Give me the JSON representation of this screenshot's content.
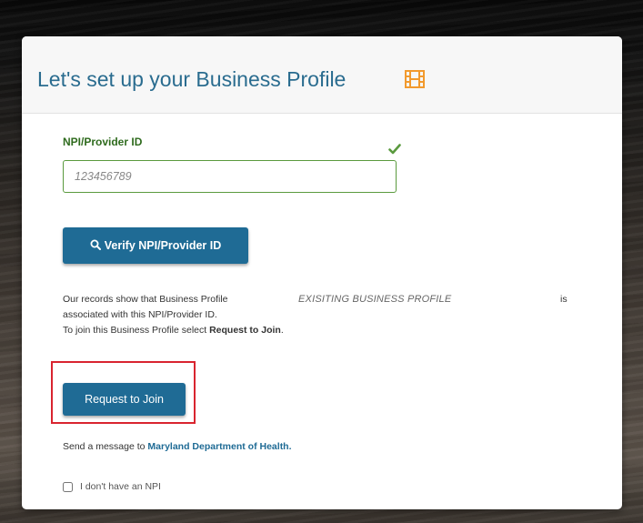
{
  "header": {
    "title": "Let's set up your Business Profile",
    "title_icon": "film-icon",
    "title_color": "#2a6c8f",
    "icon_color": "#f29a2e"
  },
  "npi_field": {
    "label": "NPI/Provider ID",
    "value": "",
    "placeholder": "123456789",
    "valid_icon": "check-icon",
    "valid_color": "#5a9a3e"
  },
  "verify_button": {
    "icon": "search-icon",
    "label": "Verify NPI/Provider ID"
  },
  "records_info": {
    "line1_text": "Our records show that Business Profile",
    "business_profile_name": "EXISITING BUSINESS PROFILE",
    "line1_suffix": "is",
    "line2_text": "associated with this NPI/Provider ID.",
    "line3_prefix": "To join this Business Profile select",
    "line3_action": "Request to Join",
    "line3_suffix": "."
  },
  "join_button": {
    "label": "Request to Join",
    "highlight_color": "#d9242f"
  },
  "message": {
    "prefix": "Send a message to",
    "link": "Maryland Department of Health.",
    "link_color": "#1f6b95"
  },
  "no_npi_checkbox": {
    "label": "I don't have an NPI",
    "checked": false
  },
  "theme": {
    "button_color": "#1f6b95"
  }
}
